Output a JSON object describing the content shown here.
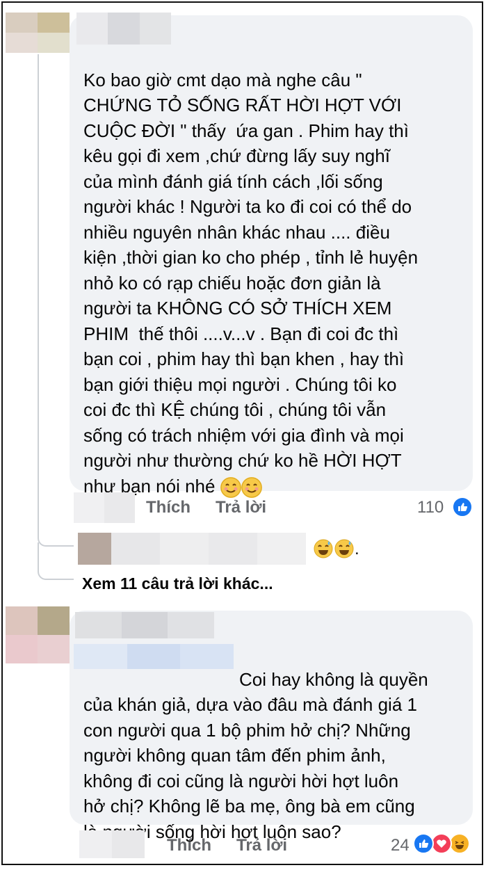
{
  "comments": [
    {
      "text": "Ko bao giờ cmt dạo mà nghe câu \"\nCHỨNG TỎ SỐNG RẤT HỜI HỢT VỚI\nCUỘC ĐỜI \" thấy  ứa gan . Phim hay thì\nkêu gọi đi xem ,chứ đừng lấy suy nghĩ\ncủa mình đánh giá tính cách ,lối sống\nngười khác ! Người ta ko đi coi có thể do\nnhiều nguyên nhân khác nhau .... điều\nkiện ,thời gian ko cho phép , tỉnh lẻ huyện\nnhỏ ko có rạp chiếu hoặc đơn giản là\nngười ta KHÔNG CÓ SỞ THÍCH XEM\nPHIM  thế thôi ....v...v . Bạn đi coi đc thì\nbạn coi , phim hay thì bạn khen , hay thì\nbạn giới thiệu mọi người . Chúng tôi ko\ncoi đc thì KỆ chúng tôi , chúng tôi vẫn\nsống có trách nhiệm với gia đình và mọi\nngười như thường chứ ko hề HỜI HỢT\nnhư bạn nói nhé ",
      "like_label": "Thích",
      "reply_label": "Trả lời",
      "reaction_count": "110"
    },
    {
      "text": "Coi hay không là quyền\ncủa khán giả, dựa vào đâu mà đánh giá 1\ncon người qua 1 bộ phim hở chị? Những\nngười không quan tâm đến phim ảnh,\nkhông đi coi cũng là người hời hợt luôn\nhở chị? Không lẽ ba mẹ, ông bà em cũng\nlà người sống hời hợt luôn sao?",
      "like_label": "Thích",
      "reply_label": "Trả lời",
      "reaction_count": "24"
    }
  ],
  "reply_preview": {
    "trailing_text": "."
  },
  "more_replies_label": "Xem 11 câu trả lời khác...",
  "icons": [
    "like-icon",
    "love-icon",
    "haha-icon",
    "smile-emoji",
    "sweat-smile-emoji"
  ],
  "colors": {
    "bubble": "#f0f2f5",
    "like_blue": "#1877f2",
    "love_red": "#f33e58",
    "haha_yellow": "#f7b125"
  }
}
